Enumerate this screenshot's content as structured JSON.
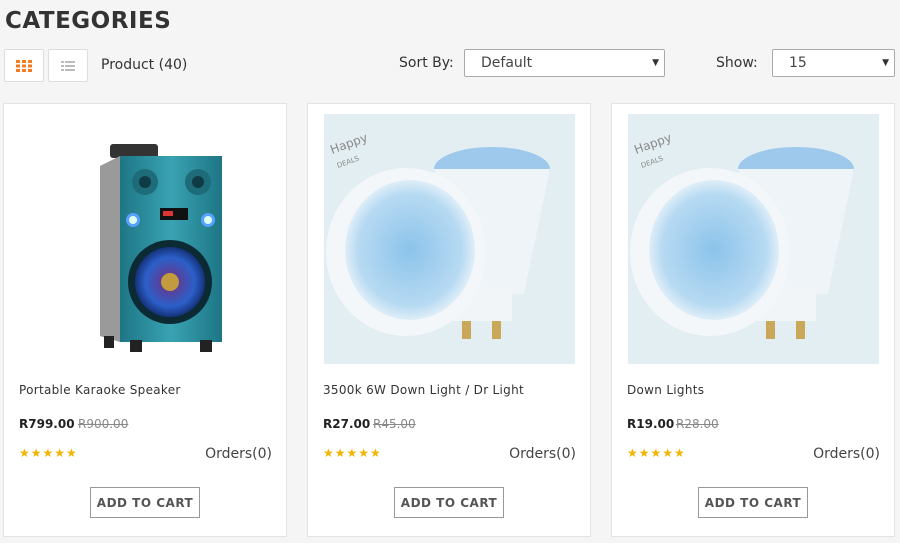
{
  "page": {
    "title": "CATEGORIES"
  },
  "toolbar": {
    "grid_view_icon": "grid-icon",
    "list_view_icon": "list-icon",
    "product_count": "Product (40)",
    "sort_label": "Sort By:",
    "sort_value": "Default",
    "show_label": "Show:",
    "show_value": "15"
  },
  "colors": {
    "accent": "#f47b20",
    "star": "#f5b301"
  },
  "products": [
    {
      "name": "Portable Karaoke Speaker",
      "price": "R799.00",
      "old_price": "R900.00",
      "stars": "★★★★★",
      "rating": 5,
      "orders": "Orders(0)",
      "cart_label": "ADD TO CART",
      "image": "speaker-image"
    },
    {
      "name": "3500k 6W Down Light / Dr Light",
      "price": "R27.00",
      "old_price": "R45.00",
      "stars": "★★★★★",
      "rating": 5,
      "orders": "Orders(0)",
      "cart_label": "ADD TO CART",
      "image": "downlight-image"
    },
    {
      "name": "Down Lights",
      "price": "R19.00",
      "old_price": "R28.00",
      "stars": "★★★★★",
      "rating": 5,
      "orders": "Orders(0)",
      "cart_label": "ADD TO CART",
      "image": "downlight-image"
    }
  ]
}
